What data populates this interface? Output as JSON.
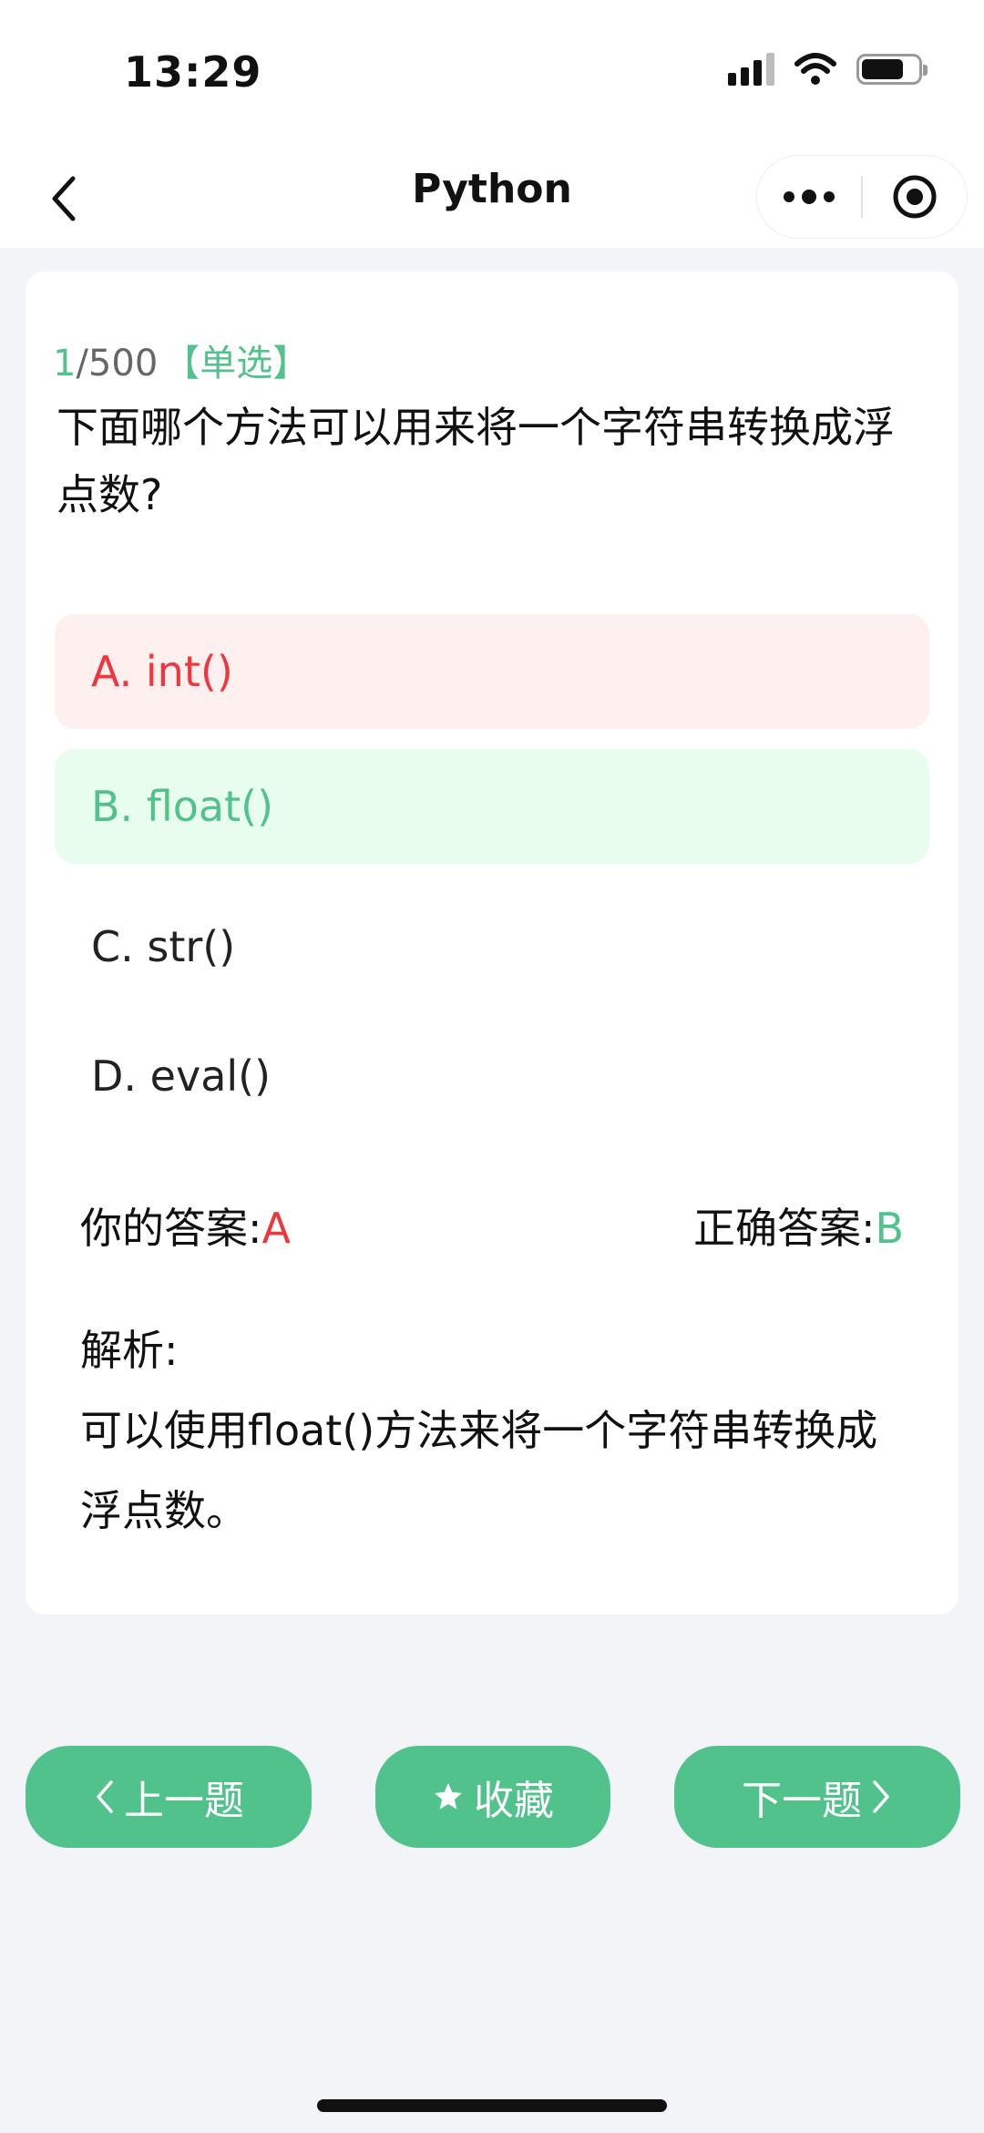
{
  "status": {
    "time": "13:29"
  },
  "nav": {
    "title": "Python"
  },
  "question": {
    "current": "1",
    "total": "/500",
    "type": "【单选】",
    "text": "下面哪个方法可以用来将一个字符串转换成浮点数?"
  },
  "options": [
    {
      "label": "A. int()",
      "state": "wrong"
    },
    {
      "label": "B. float()",
      "state": "correct"
    },
    {
      "label": "C. str()",
      "state": "normal"
    },
    {
      "label": "D. eval()",
      "state": "normal"
    }
  ],
  "result": {
    "your_label": "你的答案:",
    "your_value": "A",
    "correct_label": "正确答案:",
    "correct_value": "B"
  },
  "analysis": {
    "title": "解析:",
    "text": "可以使用float()方法来将一个字符串转换成浮点数。"
  },
  "buttons": {
    "prev": "上一题",
    "favorite": "收藏",
    "next": "下一题"
  },
  "colors": {
    "accent": "#52c28d",
    "error": "#f0363d",
    "error_bg": "#fff0f0",
    "correct_bg": "#e9fdef"
  }
}
